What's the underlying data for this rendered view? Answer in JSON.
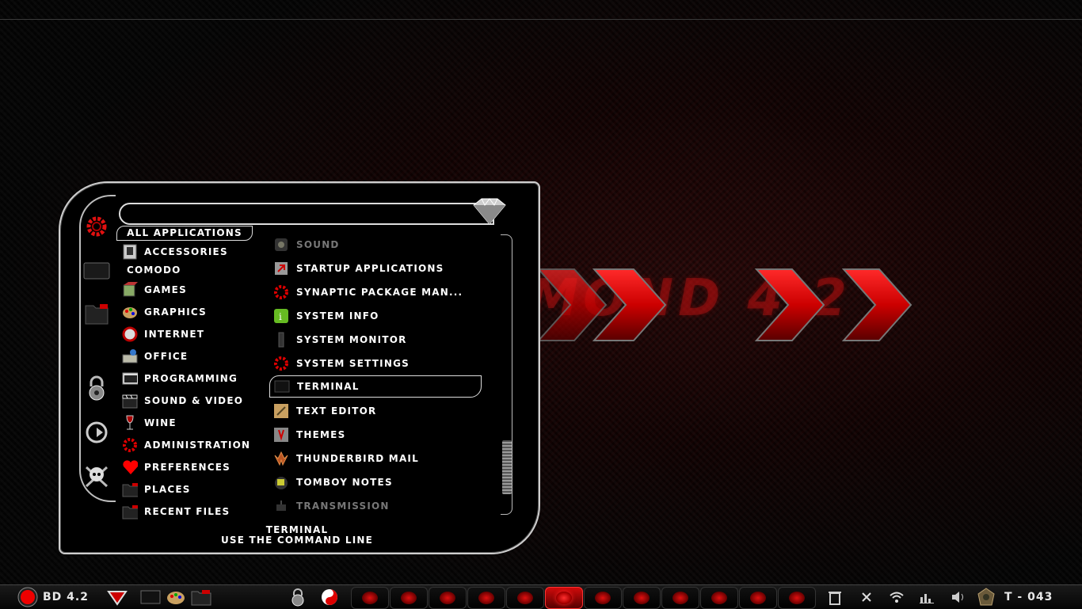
{
  "wallpaper": {
    "text": "BLACK DIAMOND 4.2"
  },
  "menu": {
    "search": {
      "value": "",
      "placeholder": ""
    },
    "tab_all": "ALL APPLICATIONS",
    "categories": [
      {
        "label": "ACCESSORIES",
        "icon": "accessories-icon"
      },
      {
        "label": "COMODO",
        "icon": ""
      },
      {
        "label": "GAMES",
        "icon": "games-icon"
      },
      {
        "label": "GRAPHICS",
        "icon": "graphics-icon"
      },
      {
        "label": "INTERNET",
        "icon": "internet-icon"
      },
      {
        "label": "OFFICE",
        "icon": "office-icon"
      },
      {
        "label": "PROGRAMMING",
        "icon": "programming-icon"
      },
      {
        "label": "SOUND & VIDEO",
        "icon": "clapperboard-icon"
      },
      {
        "label": "WINE",
        "icon": "wine-glass-icon"
      },
      {
        "label": "ADMINISTRATION",
        "icon": "gear-icon"
      },
      {
        "label": "PREFERENCES",
        "icon": "heart-icon"
      },
      {
        "label": "PLACES",
        "icon": "folder-icon"
      },
      {
        "label": "RECENT FILES",
        "icon": "folder-icon"
      }
    ],
    "apps": [
      {
        "label": "SOUND",
        "icon": "speaker-icon",
        "dim": true
      },
      {
        "label": "STARTUP APPLICATIONS",
        "icon": "startup-icon"
      },
      {
        "label": "SYNAPTIC PACKAGE MAN...",
        "icon": "gear-icon"
      },
      {
        "label": "SYSTEM INFO",
        "icon": "info-icon"
      },
      {
        "label": "SYSTEM MONITOR",
        "icon": "monitor-icon"
      },
      {
        "label": "SYSTEM SETTINGS",
        "icon": "gear-icon"
      },
      {
        "label": "TERMINAL",
        "icon": "terminal-icon",
        "selected": true
      },
      {
        "label": "TEXT EDITOR",
        "icon": "text-editor-icon"
      },
      {
        "label": "THEMES",
        "icon": "themes-icon"
      },
      {
        "label": "THUNDERBIRD MAIL",
        "icon": "thunderbird-icon"
      },
      {
        "label": "TOMBOY NOTES",
        "icon": "notes-icon"
      },
      {
        "label": "TRANSMISSION",
        "icon": "transmission-icon",
        "dim": true
      }
    ],
    "description": {
      "title": "TERMINAL",
      "subtitle": "USE THE COMMAND LINE"
    },
    "side_icons": [
      "gear-icon",
      "monitor-icon",
      "folder-icon",
      "padlock-icon",
      "logout-icon",
      "skull-icon"
    ]
  },
  "taskbar": {
    "start_label": "BD 4.2",
    "clock": "T - 043",
    "workspaces": 12,
    "active_workspace": 6,
    "colors": {
      "accent": "#d10b0b",
      "dark": "#050505"
    }
  }
}
